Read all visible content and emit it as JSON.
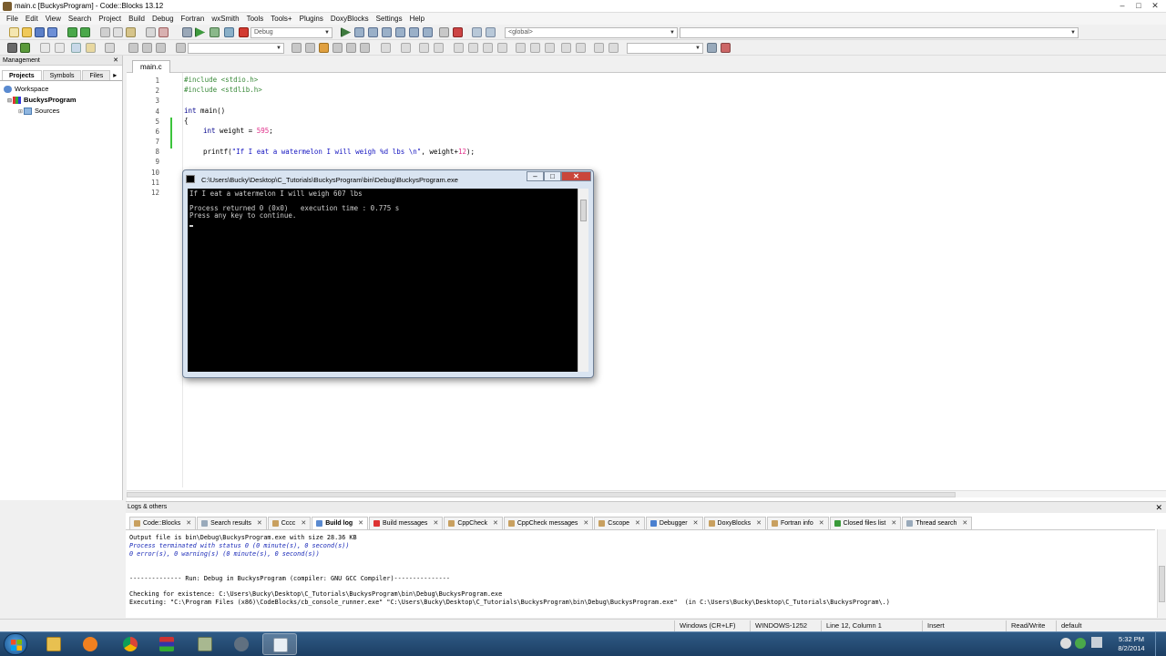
{
  "window": {
    "title": "main.c [BuckysProgram] - Code::Blocks 13.12",
    "controls": {
      "minimize": "–",
      "maximize": "□",
      "close": "✕"
    }
  },
  "menu": [
    "File",
    "Edit",
    "View",
    "Search",
    "Project",
    "Build",
    "Debug",
    "Fortran",
    "wxSmith",
    "Tools",
    "Tools+",
    "Plugins",
    "DoxyBlocks",
    "Settings",
    "Help"
  ],
  "toolbar": {
    "build_target": "Debug",
    "scope_combo": "<global>"
  },
  "management": {
    "title": "Management",
    "close": "✕",
    "tabs": [
      "Projects",
      "Symbols",
      "Files"
    ],
    "tab_arrow": "▸",
    "tree": {
      "workspace": "Workspace",
      "project": "BuckysProgram",
      "folder": "Sources"
    }
  },
  "editor": {
    "tab": "main.c",
    "line_numbers": [
      "1",
      "2",
      "3",
      "4",
      "5",
      "6",
      "7",
      "8",
      "9",
      "10",
      "11",
      "12"
    ],
    "code": {
      "l1_pp": "#include <stdio.h>",
      "l2_pp": "#include <stdlib.h>",
      "l4_kw": "int",
      "l4_rest": " main()",
      "l5": "{",
      "l6_kw": "int",
      "l6_a": " weight = ",
      "l6_num": "595",
      "l6_b": ";",
      "l8_a": "printf(",
      "l8_str": "\"If I eat a watermelon I will weigh %d lbs \\n\"",
      "l8_b": ", weight+",
      "l8_num": "12",
      "l8_c": ");"
    }
  },
  "console": {
    "title": "C:\\Users\\Bucky\\Desktop\\C_Tutorials\\BuckysProgram\\bin\\Debug\\BuckysProgram.exe",
    "lines": [
      "If I eat a watermelon I will weigh 607 lbs",
      "",
      "Process returned 0 (0x0)   execution time : 0.775 s",
      "Press any key to continue."
    ],
    "controls": {
      "minimize": "–",
      "maximize": "□",
      "close": "✕"
    }
  },
  "logs": {
    "title": "Logs & others",
    "close": "✕",
    "tabs": [
      "Code::Blocks",
      "Search results",
      "Cccc",
      "Build log",
      "Build messages",
      "CppCheck",
      "CppCheck messages",
      "Cscope",
      "Debugger",
      "DoxyBlocks",
      "Fortran info",
      "Closed files list",
      "Thread search"
    ],
    "tab_close": "✕",
    "active_tab": "Build log",
    "lines": [
      "Output file is bin\\Debug\\BuckysProgram.exe with size 28.36 KB",
      "Process terminated with status 0 (0 minute(s), 0 second(s))",
      "0 error(s), 0 warning(s) (0 minute(s), 0 second(s))",
      "",
      "",
      "-------------- Run: Debug in BuckysProgram (compiler: GNU GCC Compiler)---------------",
      "",
      "Checking for existence: C:\\Users\\Bucky\\Desktop\\C_Tutorials\\BuckysProgram\\bin\\Debug\\BuckysProgram.exe",
      "Executing: \"C:\\Program Files (x86)\\CodeBlocks/cb_console_runner.exe\" \"C:\\Users\\Bucky\\Desktop\\C_Tutorials\\BuckysProgram\\bin\\Debug\\BuckysProgram.exe\"  (in C:\\Users\\Bucky\\Desktop\\C_Tutorials\\BuckysProgram\\.)"
    ]
  },
  "status": {
    "line_endings": "Windows (CR+LF)",
    "encoding": "WINDOWS-1252",
    "position": "Line 12, Column 1",
    "mode": "Insert",
    "access": "Read/Write",
    "profile": "default"
  },
  "taskbar": {
    "time": "5:32 PM",
    "date": "8/2/2014",
    "apps": [
      "explorer",
      "media-player",
      "chrome",
      "winrar",
      "codeblocks",
      "camtasia",
      "notepad"
    ]
  },
  "colors": {
    "change_marker": "#3cc43c",
    "preprocessor": "#3a8a3a",
    "keyword": "#00008b",
    "number": "#e0308a",
    "string": "#1515c0",
    "console_bg": "#000000"
  }
}
